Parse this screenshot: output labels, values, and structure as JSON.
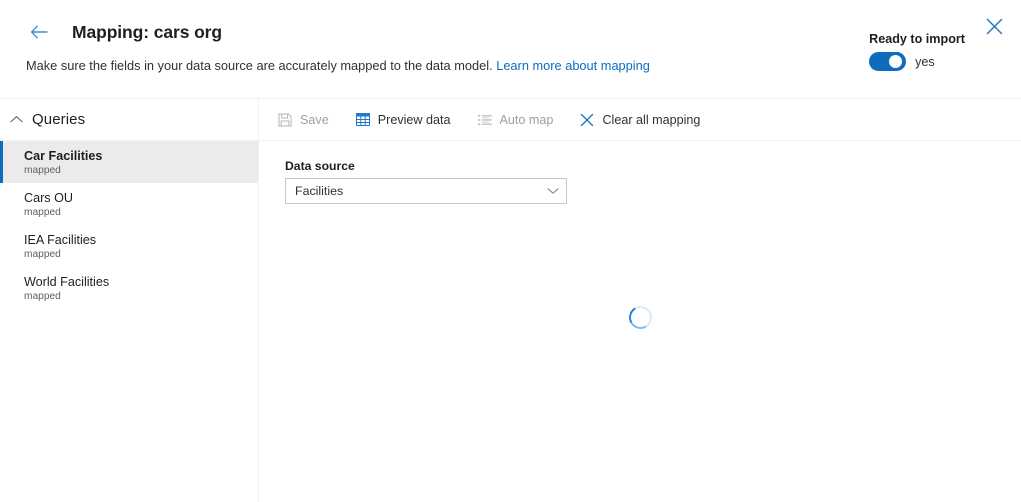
{
  "header": {
    "back_icon": "arrow-left-icon",
    "title": "Mapping: cars org",
    "subtitle_text": "Make sure the fields in your data source are accurately mapped to the data model. ",
    "subtitle_link": "Learn more about mapping",
    "ready_label": "Ready to import",
    "toggle_value": "yes",
    "toggle_on": true,
    "close_icon": "close-icon"
  },
  "sidebar": {
    "section_title": "Queries",
    "collapse_icon": "chevron-up-icon",
    "items": [
      {
        "name": "Car Facilities",
        "status": "mapped",
        "selected": true
      },
      {
        "name": "Cars OU",
        "status": "mapped",
        "selected": false
      },
      {
        "name": "IEA Facilities",
        "status": "mapped",
        "selected": false
      },
      {
        "name": "World Facilities",
        "status": "mapped",
        "selected": false
      }
    ]
  },
  "toolbar": {
    "buttons": [
      {
        "label": "Save",
        "icon": "save-icon",
        "enabled": false
      },
      {
        "label": "Preview data",
        "icon": "table-grid-icon",
        "enabled": true
      },
      {
        "label": "Auto map",
        "icon": "list-icon",
        "enabled": false
      },
      {
        "label": "Clear all mapping",
        "icon": "close-icon",
        "enabled": true
      }
    ]
  },
  "main": {
    "data_source_label": "Data source",
    "data_source_value": "Facilities",
    "dropdown_icon": "chevron-down-icon",
    "loading": true,
    "loading_icon": "spinner-icon"
  },
  "colors": {
    "accent": "#0f6cbd",
    "link": "#0f6cbd",
    "selected_bg": "#edebe9",
    "disabled_text": "#a19f9d",
    "divider": "#f3f2f1"
  }
}
